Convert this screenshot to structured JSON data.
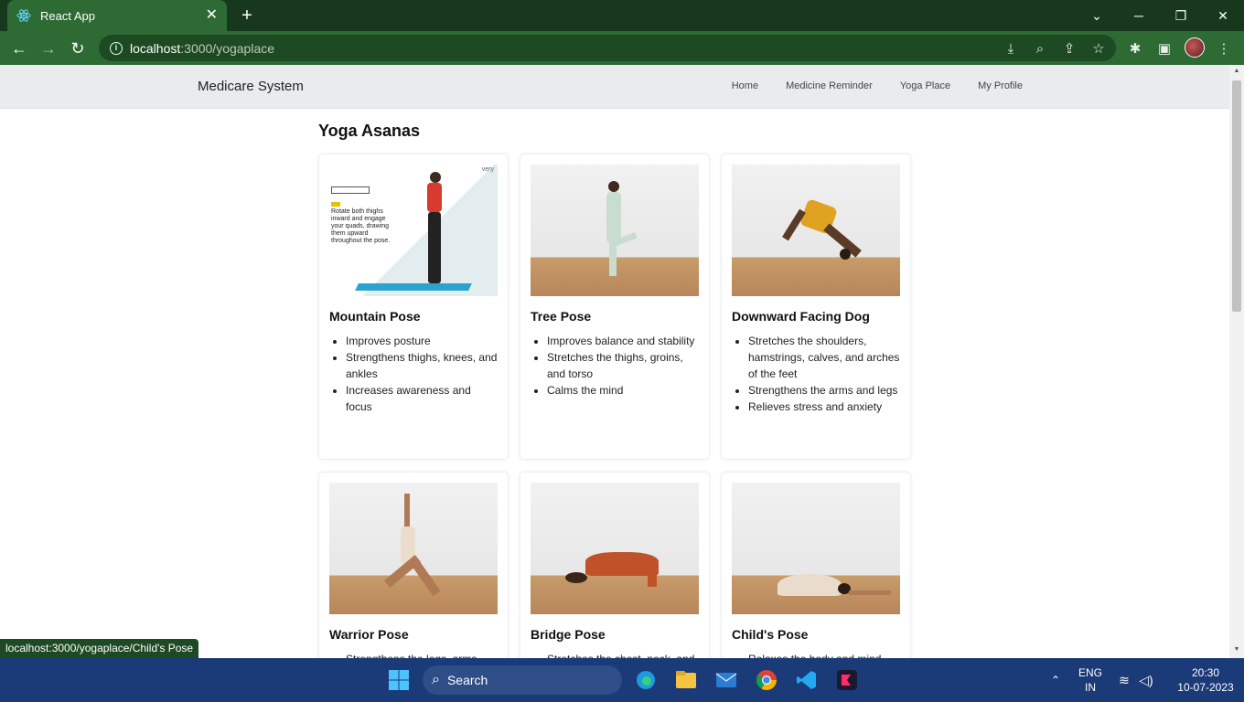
{
  "browser": {
    "tab_title": "React App",
    "url_host": "localhost",
    "url_path": ":3000/yogaplace",
    "status_url": "localhost:3000/yogaplace/Child's Pose"
  },
  "app": {
    "brand": "Medicare System",
    "nav": [
      "Home",
      "Medicine Reminder",
      "Yoga Place",
      "My Profile"
    ],
    "heading": "Yoga Asanas"
  },
  "asanas": [
    {
      "title": "Mountain Pose",
      "benefits": [
        "Improves posture",
        "Strengthens thighs, knees, and ankles",
        "Increases awareness and focus"
      ],
      "photo_text": [
        "Rotate both thighs",
        "inward and engage",
        "your quads, drawing",
        "them upward",
        "throughout the pose."
      ],
      "photo_brand": "very"
    },
    {
      "title": "Tree Pose",
      "benefits": [
        "Improves balance and stability",
        "Stretches the thighs, groins, and torso",
        "Calms the mind"
      ]
    },
    {
      "title": "Downward Facing Dog",
      "benefits": [
        "Stretches the shoulders, hamstrings, calves, and arches of the feet",
        "Strengthens the arms and legs",
        "Relieves stress and anxiety"
      ]
    },
    {
      "title": "Warrior Pose",
      "benefits": [
        "Strengthens the legs, arms, and"
      ]
    },
    {
      "title": "Bridge Pose",
      "benefits": [
        "Stretches the chest, neck, and"
      ]
    },
    {
      "title": "Child's Pose",
      "benefits": [
        "Relaxes the body and mind"
      ]
    }
  ],
  "taskbar": {
    "search_label": "Search",
    "lang": "ENG",
    "region": "IN",
    "time": "20:30",
    "date": "10-07-2023"
  },
  "colors": {
    "browser_frame": "#2d6a34",
    "navbar_bg": "#e9ebed",
    "taskbar_bg": "#1b3a78"
  }
}
